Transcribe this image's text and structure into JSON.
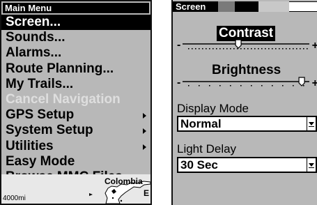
{
  "main_menu": {
    "title": "Main Menu",
    "items": [
      {
        "label": "Screen...",
        "state": "selected",
        "submenu": false
      },
      {
        "label": "Sounds...",
        "state": "normal",
        "submenu": false
      },
      {
        "label": "Alarms...",
        "state": "normal",
        "submenu": false
      },
      {
        "label": "Route Planning...",
        "state": "normal",
        "submenu": false
      },
      {
        "label": "My Trails...",
        "state": "normal",
        "submenu": false
      },
      {
        "label": "Cancel Navigation",
        "state": "disabled",
        "submenu": false
      },
      {
        "label": "GPS Setup",
        "state": "normal",
        "submenu": true
      },
      {
        "label": "System Setup",
        "state": "normal",
        "submenu": true
      },
      {
        "label": "Utilities",
        "state": "normal",
        "submenu": true
      },
      {
        "label": "Easy Mode",
        "state": "normal",
        "submenu": false
      },
      {
        "label": "Browse MMC Files...",
        "state": "normal",
        "submenu": false
      }
    ]
  },
  "map": {
    "city_label": "Colombia",
    "scale_label": "4000mi",
    "edge_letter": "E"
  },
  "screen_panel": {
    "title": "Screen",
    "contrast": {
      "label": "Contrast",
      "value": 0.44,
      "minus": "-",
      "plus": "+"
    },
    "brightness": {
      "label": "Brightness",
      "value": 0.94,
      "minus": "-",
      "plus": "+"
    },
    "display_mode": {
      "label": "Display Mode",
      "value": "Normal"
    },
    "light_delay": {
      "label": "Light Delay",
      "value": "30 Sec"
    }
  },
  "colors": {
    "panel_bg": "#b8b8b8",
    "selected_bg": "#000000",
    "disabled_text": "#dedede"
  }
}
